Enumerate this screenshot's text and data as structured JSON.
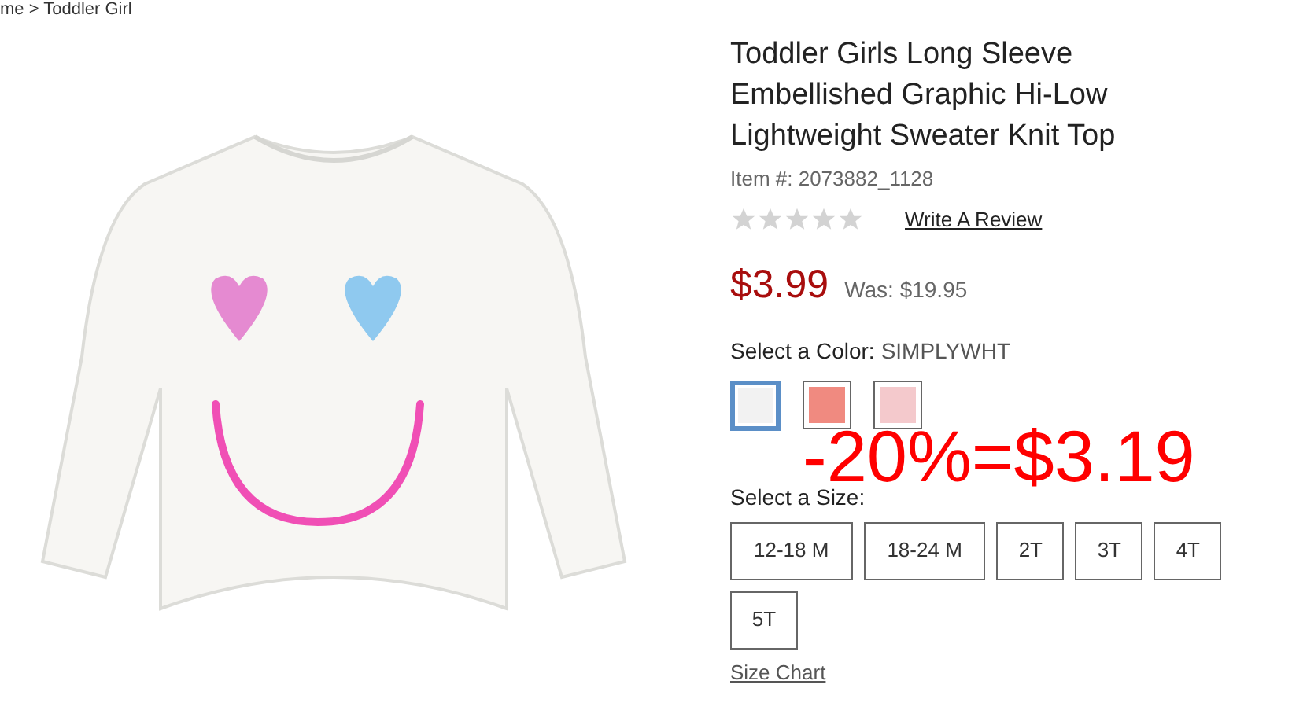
{
  "breadcrumb": "me > Toddler Girl",
  "product": {
    "title": "Toddler Girls Long Sleeve Embellished Graphic Hi-Low Lightweight Sweater Knit Top",
    "item_number": "Item #: 2073882_1128",
    "stars": 0,
    "review_link": "Write A Review",
    "price": "$3.99",
    "was_price": "Was: $19.95"
  },
  "color": {
    "label": "Select a Color:",
    "value": "SIMPLYWHT",
    "swatches": [
      {
        "selected": true,
        "color": "#f2f2f2"
      },
      {
        "selected": false,
        "color": "#f08a80"
      },
      {
        "selected": false,
        "color": "#f4c9cc"
      }
    ]
  },
  "overlay_note": "-20%=$3.19",
  "size": {
    "label": "Select a Size:",
    "options": [
      {
        "label": "12-18 M",
        "selected": false
      },
      {
        "label": "18-24 M",
        "selected": false
      },
      {
        "label": "2T",
        "selected": false
      },
      {
        "label": "3T",
        "selected": false
      },
      {
        "label": "4T",
        "selected": false
      },
      {
        "label": "5T",
        "selected": false
      }
    ],
    "chart_link": "Size Chart"
  }
}
